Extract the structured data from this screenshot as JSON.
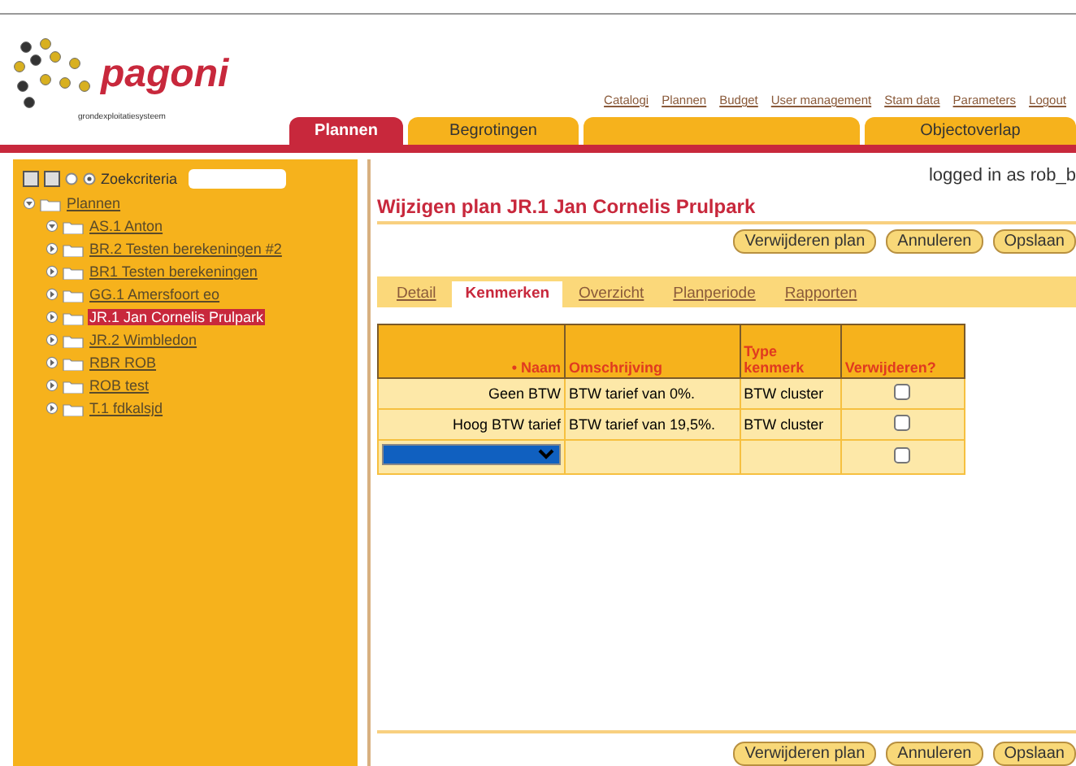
{
  "header": {
    "logo": "pagoni",
    "tagline": "grondexploitatiesysteem",
    "links": [
      "Catalogi",
      "Plannen",
      "Budget",
      "User management",
      "Stam data",
      "Parameters",
      "Logout"
    ]
  },
  "tabs": [
    {
      "label": "Plannen",
      "selected": true
    },
    {
      "label": "Begrotingen",
      "selected": false
    },
    {
      "selected": false
    },
    {
      "label": "Objectoverlap",
      "selected": false
    }
  ],
  "sidebar": {
    "search_label": "Zoekcriteria",
    "tree": [
      {
        "label": "Plannen",
        "expanded": true,
        "selected": false,
        "children": [
          {
            "label": "AS.1 Anton",
            "expanded": true,
            "selected": false
          },
          {
            "label": "BR.2 Testen berekeningen #2",
            "expanded": false,
            "selected": false
          },
          {
            "label": "BR1 Testen berekeningen",
            "expanded": false,
            "selected": false
          },
          {
            "label": "GG.1 Amersfoort eo",
            "expanded": false,
            "selected": false
          },
          {
            "label": "JR.1 Jan Cornelis Prulpark",
            "expanded": false,
            "selected": true
          },
          {
            "label": "JR.2 Wimbledon",
            "expanded": false,
            "selected": false
          },
          {
            "label": "RBR ROB",
            "expanded": false,
            "selected": false
          },
          {
            "label": "ROB test",
            "expanded": false,
            "selected": false
          },
          {
            "label": "T.1 fdkalsjd",
            "expanded": false,
            "selected": false
          }
        ]
      }
    ]
  },
  "main": {
    "user": "logged in as rob_b",
    "title": "Wijzigen plan JR.1 Jan Cornelis Prulpark",
    "buttons": [
      "Verwijderen plan",
      "Annuleren",
      "Opslaan"
    ],
    "subtabs": [
      {
        "label": "Detail",
        "selected": false
      },
      {
        "label": "Kenmerken",
        "selected": true
      },
      {
        "label": "Overzicht",
        "selected": false
      },
      {
        "label": "Planperiode",
        "selected": false
      },
      {
        "label": "Rapporten",
        "selected": false
      }
    ],
    "table": {
      "columns": [
        "• Naam",
        "Omschrijving",
        "Type kenmerk",
        "Verwijderen?"
      ],
      "rows": [
        {
          "kind": "text",
          "naam": "Geen BTW",
          "omschrijving": "BTW tarief van 0%.",
          "type": "BTW cluster",
          "checked": false
        },
        {
          "kind": "text",
          "naam": "Hoog BTW tarief",
          "omschrijving": "BTW tarief van 19,5%.",
          "type": "BTW cluster",
          "checked": false
        },
        {
          "kind": "select",
          "checked": false
        }
      ]
    },
    "bottom_buttons": [
      "Verwijderen plan",
      "Annuleren",
      "Opslaan"
    ]
  }
}
